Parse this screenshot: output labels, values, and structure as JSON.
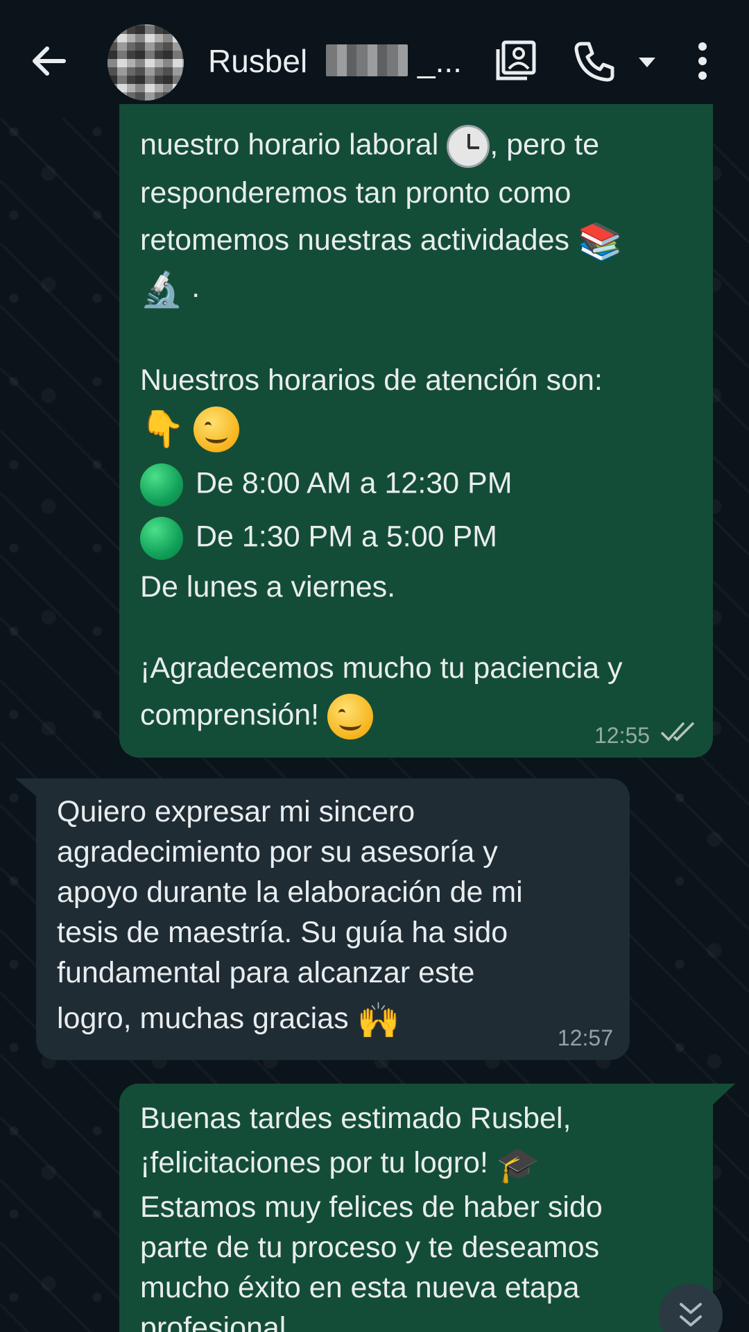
{
  "header": {
    "contact_name": "Rusbel",
    "contact_suffix": "_...",
    "back_icon": "arrow-left-icon",
    "contact_card_icon": "contact-card-icon",
    "call_icon": "phone-icon",
    "call_dropdown_icon": "caret-down-icon",
    "menu_icon": "more-vertical-icon"
  },
  "messages": [
    {
      "direction": "outgoing",
      "lines": [
        "nuestro horario laboral",
        ", pero te",
        "responderemos tan pronto como",
        "retomemos nuestras actividades",
        ".",
        "Nuestros horarios de atención son:",
        "De 8:00 AM a 12:30 PM",
        "De 1:30 PM a 5:00 PM",
        "De lunes a viernes.",
        "¡Agradecemos mucho tu paciencia y",
        "comprensión!"
      ],
      "time": "12:55",
      "status": "read"
    },
    {
      "direction": "incoming",
      "lines": [
        "Quiero expresar mi sincero",
        "agradecimiento por su asesoría y",
        "apoyo durante la elaboración de mi",
        "tesis de maestría. Su guía ha sido",
        "fundamental para alcanzar este",
        "logro, muchas gracias"
      ],
      "time": "12:57"
    },
    {
      "direction": "outgoing",
      "lines": [
        "Buenas tardes estimado Rusbel,",
        "¡felicitaciones por tu logro!",
        "Estamos muy felices de haber sido",
        "parte de tu proceso y te deseamos",
        "mucho éxito en esta nueva etapa",
        "profesional."
      ]
    }
  ],
  "emojis": {
    "books": "📚",
    "microscope": "🔬",
    "point_down": "👇",
    "raised_hands": "🙌",
    "grad_cap": "🎓"
  },
  "colors": {
    "outgoing_bubble": "#144d37",
    "incoming_bubble": "#1f2c34",
    "background": "#0b141a",
    "text": "#e9edef",
    "read_ticks": "#e9edef"
  },
  "scroll_down_icon": "double-chevron-down-icon"
}
